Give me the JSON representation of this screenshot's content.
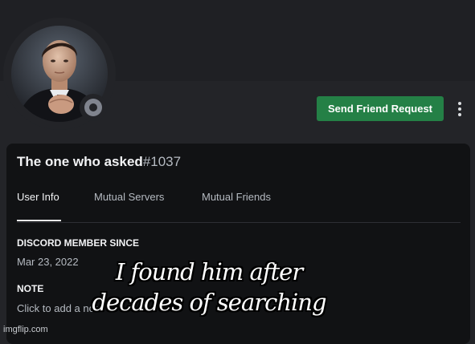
{
  "profile": {
    "display_name": "The one who asked",
    "discriminator": "#1037",
    "status": "offline"
  },
  "actions": {
    "send_friend_request_label": "Send Friend Request",
    "more_icon": "vertical-ellipsis-icon"
  },
  "tabs": [
    {
      "label": "User Info",
      "active": true
    },
    {
      "label": "Mutual Servers",
      "active": false
    },
    {
      "label": "Mutual Friends",
      "active": false
    }
  ],
  "member_since": {
    "title": "DISCORD MEMBER SINCE",
    "value": "Mar 23, 2022"
  },
  "note": {
    "title": "NOTE",
    "placeholder": "Click to add a note"
  },
  "caption": {
    "line1": "I found him after",
    "line2": "decades of searching"
  },
  "watermark": "imgflip.com",
  "colors": {
    "background": "#232428",
    "card": "#111214",
    "button": "#248046",
    "status_offline": "#80848e"
  }
}
